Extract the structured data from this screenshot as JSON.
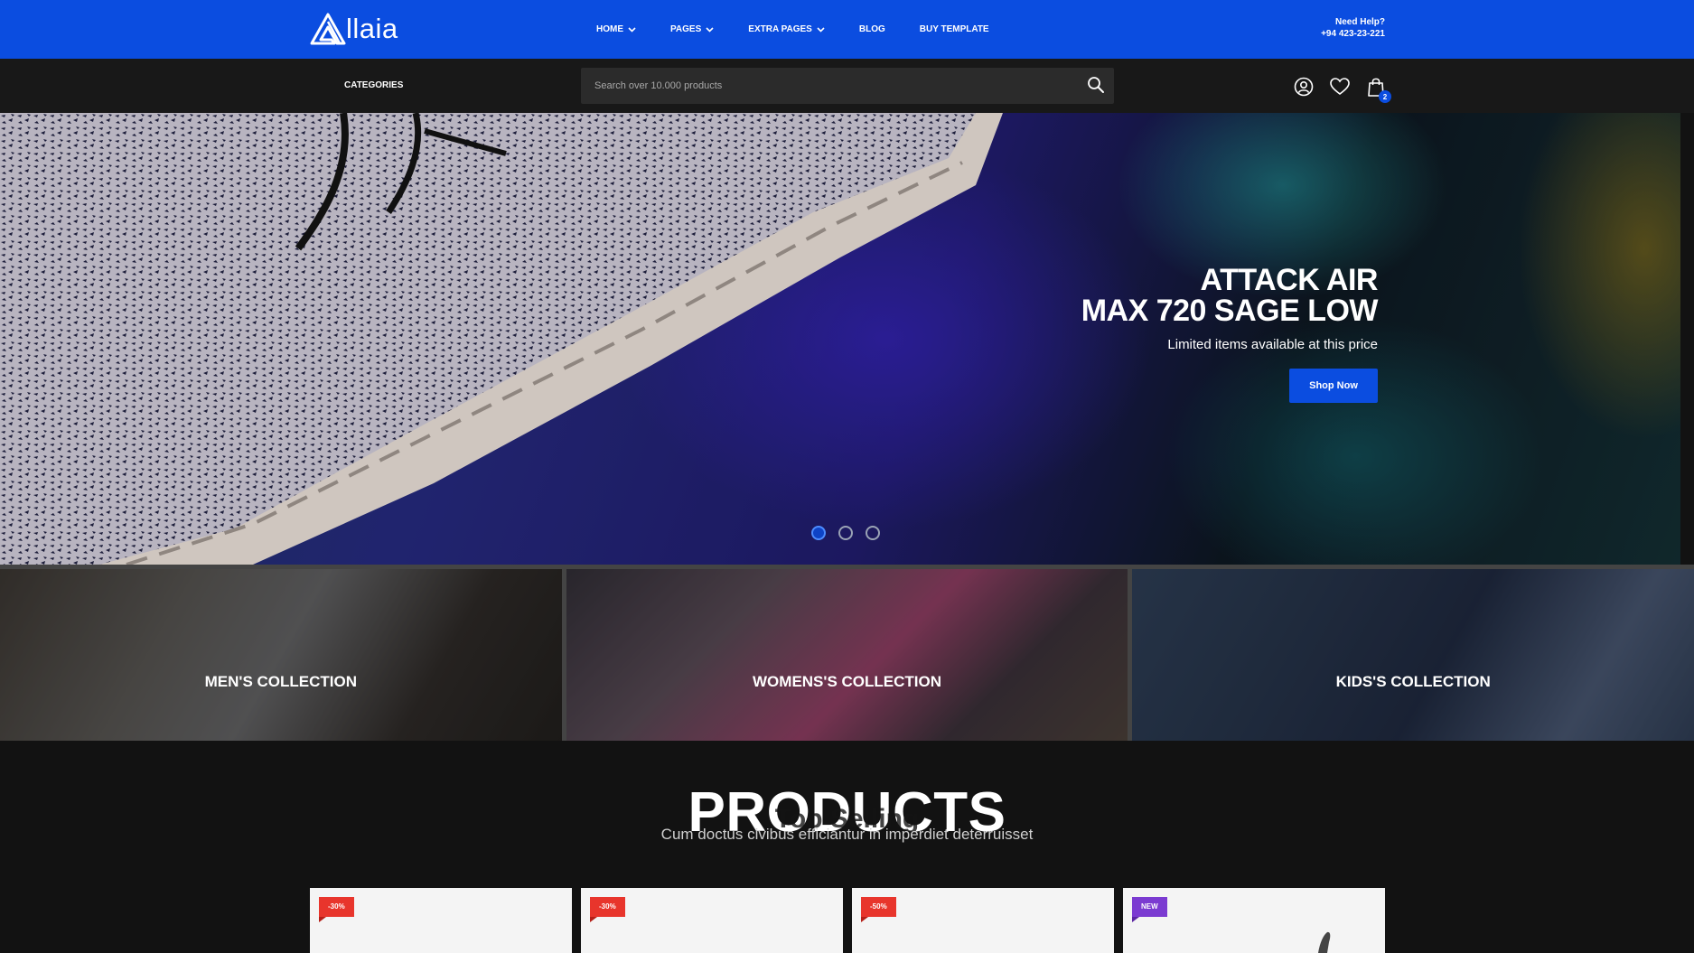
{
  "brand": {
    "name": "llaia"
  },
  "nav": {
    "items": [
      {
        "label": "HOME",
        "dropdown": true
      },
      {
        "label": "PAGES",
        "dropdown": true
      },
      {
        "label": "EXTRA PAGES",
        "dropdown": true
      },
      {
        "label": "BLOG",
        "dropdown": false
      },
      {
        "label": "BUY TEMPLATE",
        "dropdown": false
      }
    ]
  },
  "help": {
    "title": "Need Help?",
    "phone": "+94 423-23-221"
  },
  "subbar": {
    "categories_label": "CATEGORIES",
    "search_placeholder": "Search over 10.000 products",
    "cart_count": "2"
  },
  "hero": {
    "title_line1": "ATTACK AIR",
    "title_line2": "MAX 720 SAGE LOW",
    "subtitle": "Limited items available at this price",
    "button_label": "Shop Now",
    "slides": 3,
    "active_slide": 1
  },
  "collections": [
    {
      "label": "MEN'S COLLECTION"
    },
    {
      "label": "WOMENS'S COLLECTION"
    },
    {
      "label": "KIDS'S COLLECTION"
    }
  ],
  "products": {
    "title": "PRODUCTS",
    "overlay_title": "Top Selling",
    "subtitle": "Cum doctus civibus efficiantur in imperdiet deterruisset",
    "cards": [
      {
        "badge": "-30%",
        "badge_type": "sale"
      },
      {
        "badge": "-30%",
        "badge_type": "sale"
      },
      {
        "badge": "-50%",
        "badge_type": "sale"
      },
      {
        "badge": "NEW",
        "badge_type": "new"
      }
    ]
  },
  "colors": {
    "accent": "#0b4de0",
    "sale": "#e8352c",
    "new": "#7b3bd1",
    "dark": "#121212"
  }
}
